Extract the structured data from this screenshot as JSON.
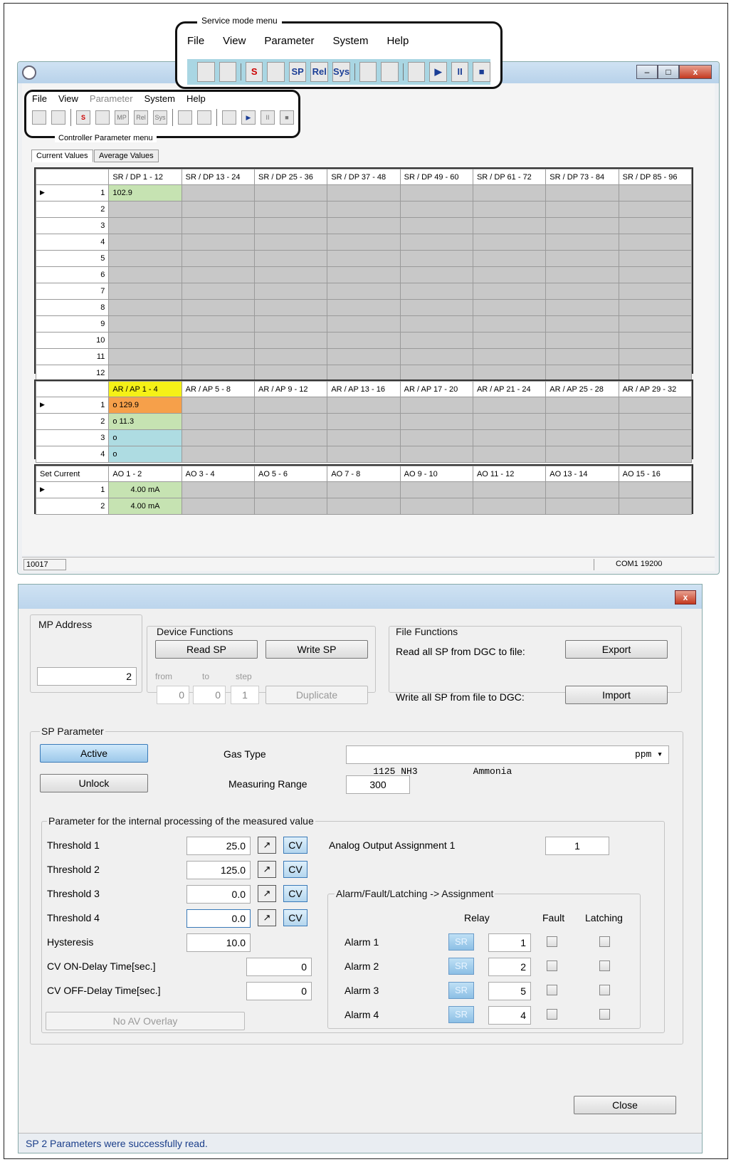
{
  "service_menu": {
    "caption": "Service mode menu",
    "menus": [
      "File",
      "View",
      "Parameter",
      "System",
      "Help"
    ]
  },
  "controller_menu": {
    "caption": "Controller Parameter menu",
    "menus": [
      "File",
      "View",
      "Parameter",
      "System",
      "Help"
    ]
  },
  "toolbar_glyphs": {
    "s": "S",
    "sp": "SP",
    "rel": "Rel",
    "sys": "Sys",
    "mp": "MP",
    "play": "▶",
    "pause": "II",
    "stop": "■"
  },
  "window_buttons": {
    "min": "–",
    "max": "□",
    "close": "x"
  },
  "tabs": [
    "Current Values",
    "Average Values"
  ],
  "sr_grid": {
    "headers": [
      "",
      "SR / DP 1 - 12",
      "SR / DP 13 - 24",
      "SR / DP 25 - 36",
      "SR / DP 37 - 48",
      "SR / DP 49 - 60",
      "SR / DP 61 - 72",
      "SR / DP 73 - 84",
      "SR / DP 85 - 96"
    ],
    "rows": [
      "1",
      "2",
      "3",
      "4",
      "5",
      "6",
      "7",
      "8",
      "9",
      "10",
      "11",
      "12"
    ],
    "value_1": "102.9"
  },
  "ar_grid": {
    "headers": [
      "",
      "AR / AP 1 - 4",
      "AR / AP 5 - 8",
      "AR / AP 9 - 12",
      "AR / AP 13 - 16",
      "AR / AP 17 - 20",
      "AR / AP 21 - 24",
      "AR / AP 25 - 28",
      "AR / AP 29 - 32"
    ],
    "rows": [
      "1",
      "2",
      "3",
      "4"
    ],
    "values": [
      "o  129.9",
      "o  11.3",
      "o",
      "o"
    ]
  },
  "ao_grid": {
    "headers": [
      "Set Current",
      "AO 1 - 2",
      "AO 3 - 4",
      "AO 5 - 6",
      "AO 7 - 8",
      "AO 9 - 10",
      "AO 11 - 12",
      "AO 13 - 14",
      "AO 15 - 16"
    ],
    "rows": [
      "1",
      "2"
    ],
    "values": [
      "4.00 mA",
      "4.00 mA"
    ]
  },
  "status1": {
    "left": "10017",
    "right": "COM1  19200"
  },
  "dialog": {
    "close_x": "x",
    "mp_address": {
      "label": "MP Address",
      "value": "2"
    },
    "device_functions": {
      "label": "Device Functions",
      "read": "Read SP",
      "write": "Write SP",
      "from_label": "from",
      "to_label": "to",
      "step_label": "step",
      "from": "0",
      "to": "0",
      "step": "1",
      "duplicate": "Duplicate"
    },
    "file_functions": {
      "label": "File Functions",
      "read_label": "Read all SP from DGC to file:",
      "export": "Export",
      "write_label": "Write all SP from file to DGC:",
      "import": "Import"
    },
    "sp_parameter": {
      "label": "SP Parameter",
      "active": "Active",
      "unlock": "Unlock",
      "gas_type_label": "Gas Type",
      "gas_type_value": "1125 NH3          Ammonia",
      "gas_unit": "ppm",
      "measuring_range_label": "Measuring Range",
      "measuring_range": "300"
    },
    "internal": {
      "label": "Parameter for the internal processing of the measured value",
      "thresholds": [
        {
          "label": "Threshold 1",
          "value": "25.0"
        },
        {
          "label": "Threshold 2",
          "value": "125.0"
        },
        {
          "label": "Threshold 3",
          "value": "0.0"
        },
        {
          "label": "Threshold 4",
          "value": "0.0"
        }
      ],
      "cv": "CV",
      "arrow": "↗",
      "hysteresis_label": "Hysteresis",
      "hysteresis": "10.0",
      "cv_on_label": "CV ON-Delay Time[sec.]",
      "cv_on": "0",
      "cv_off_label": "CV OFF-Delay Time[sec.]",
      "cv_off": "0",
      "no_av": "No AV Overlay",
      "aoa_label": "Analog Output Assignment 1",
      "aoa_value": "1"
    },
    "alarm_group": {
      "label": "Alarm/Fault/Latching -> Assignment",
      "relay": "Relay",
      "fault": "Fault",
      "latching": "Latching",
      "sr": "SR",
      "alarms": [
        {
          "label": "Alarm 1",
          "relay": "1"
        },
        {
          "label": "Alarm 2",
          "relay": "2"
        },
        {
          "label": "Alarm 3",
          "relay": "5"
        },
        {
          "label": "Alarm 4",
          "relay": "4"
        }
      ]
    },
    "close": "Close",
    "status": "SP 2 Parameters were successfully read."
  }
}
